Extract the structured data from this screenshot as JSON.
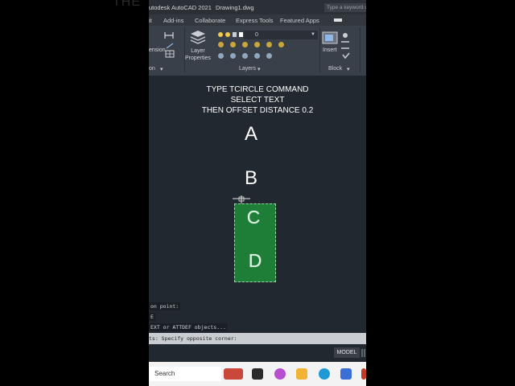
{
  "window": {
    "app_title": "utodesk AutoCAD 2021",
    "file_name": "Drawing1.dwg",
    "search_placeholder": "Type a keyword or phrase"
  },
  "menu": {
    "items": [
      "it",
      "Add-ins",
      "Collaborate",
      "Express Tools",
      "Featured Apps"
    ]
  },
  "ribbon": {
    "dimension_label": "ension",
    "layer_properties_label": "Layer\nProperties",
    "layer_dropdown_value": "0",
    "layers_panel_title": "Layers",
    "insert_label": "Insert",
    "block_panel_title": "Block",
    "annotation_panel_title": "on",
    "left_arrow_mark": "▾"
  },
  "canvas": {
    "instructions": [
      "TYPE TCIRCLE COMMAND",
      "SELECT TEXT",
      "THEN OFFSET DISTANCE 0.2"
    ],
    "letters": [
      "A",
      "B",
      "C",
      "D"
    ]
  },
  "command_history": [
    "on point:",
    "E",
    "EXT or ATTDEF objects..."
  ],
  "command_line": "ts: Specify opposite corner:",
  "status": {
    "model_tab": "MODEL"
  },
  "taskbar": {
    "search_label": "Search"
  },
  "colors": {
    "canvas_bg": "#212830",
    "selection_fill": "#1e7d36",
    "ribbon_bg": "#3a4049"
  }
}
